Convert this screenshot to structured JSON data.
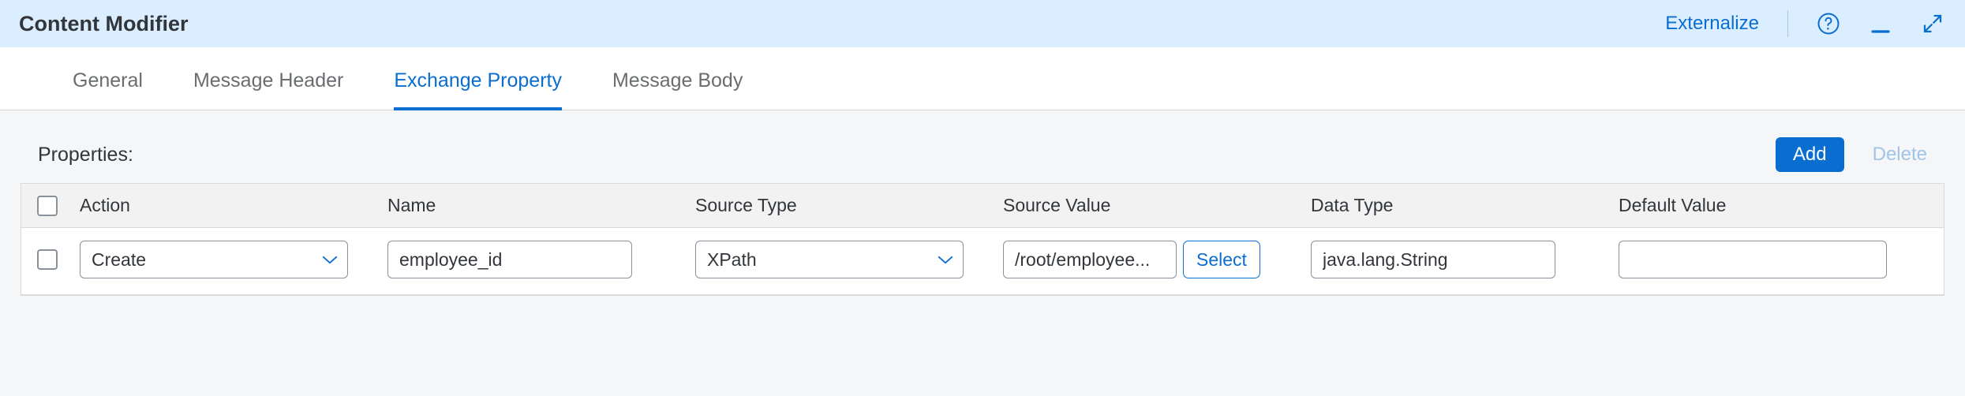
{
  "header": {
    "title": "Content Modifier",
    "externalize": "Externalize"
  },
  "tabs": [
    {
      "id": "general",
      "label": "General",
      "active": false
    },
    {
      "id": "message-header",
      "label": "Message Header",
      "active": false
    },
    {
      "id": "exchange-property",
      "label": "Exchange Property",
      "active": true
    },
    {
      "id": "message-body",
      "label": "Message Body",
      "active": false
    }
  ],
  "section": {
    "title": "Properties:",
    "add_label": "Add",
    "delete_label": "Delete"
  },
  "columns": {
    "action": "Action",
    "name": "Name",
    "source_type": "Source Type",
    "source_value": "Source Value",
    "data_type": "Data Type",
    "default_value": "Default Value"
  },
  "rows": [
    {
      "action": "Create",
      "name": "employee_id",
      "source_type": "XPath",
      "source_value": "/root/employee...",
      "select_label": "Select",
      "data_type": "java.lang.String",
      "default_value": ""
    }
  ]
}
